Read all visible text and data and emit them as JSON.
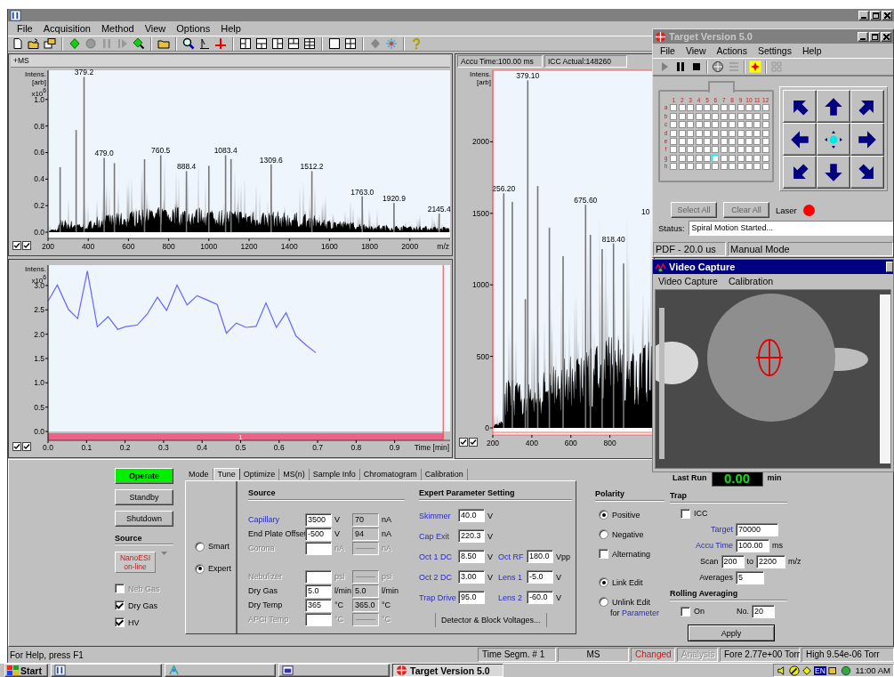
{
  "main_window": {
    "menu": [
      "File",
      "Acquisition",
      "Method",
      "View",
      "Options",
      "Help"
    ]
  },
  "spectrum": {
    "title": "+MS",
    "y_exponent": "x10$^{6}$",
    "trace_toggles": [
      {
        "checked": true
      },
      {
        "checked": true
      }
    ],
    "chart_data": {
      "type": "bar",
      "xlabel": "m/z",
      "ylabel": "Intens. [arb]",
      "xlim": [
        200,
        2200
      ],
      "ylim": [
        0,
        1.22
      ],
      "x": [
        260,
        340,
        379.2,
        479.0,
        530,
        680,
        760.5,
        888.4,
        1000,
        1083.4,
        1110,
        1309.6,
        1512.2,
        1763.0,
        1920.9,
        2145.4
      ],
      "values": [
        0.49,
        0.77,
        1.17,
        0.56,
        0.52,
        0.55,
        0.58,
        0.46,
        0.5,
        0.58,
        0.55,
        0.51,
        0.46,
        0.27,
        0.22,
        0.14
      ],
      "xticks": [
        200,
        400,
        600,
        800,
        1000,
        1200,
        1400,
        1600,
        1800,
        2000
      ],
      "yticks": [
        {
          "value": 0,
          "label": "0.0"
        },
        {
          "value": 0.2,
          "label": "0.2"
        },
        {
          "value": 0.4,
          "label": "0.4"
        },
        {
          "value": 0.6,
          "label": "0.6"
        },
        {
          "value": 0.8,
          "label": "0.8"
        },
        {
          "value": 1.0,
          "label": "1.0"
        }
      ],
      "annotations": [
        {
          "x": 379.2,
          "y": 1.17,
          "text": "379.2"
        },
        {
          "x": 479.0,
          "y": 0.56,
          "text": "479.0"
        },
        {
          "x": 760.5,
          "y": 0.58,
          "text": "760.5"
        },
        {
          "x": 888.4,
          "y": 0.46,
          "text": "888.4"
        },
        {
          "x": 1083.4,
          "y": 0.58,
          "text": "1083.4"
        },
        {
          "x": 1309.6,
          "y": 0.51,
          "text": "1309.6"
        },
        {
          "x": 1512.2,
          "y": 0.46,
          "text": "1512.2"
        },
        {
          "x": 1763.0,
          "y": 0.27,
          "text": "1763.0"
        },
        {
          "x": 1920.9,
          "y": 0.22,
          "text": "1920.9"
        },
        {
          "x": 2145.4,
          "y": 0.14,
          "text": "2145.4"
        }
      ]
    }
  },
  "live_spectrum": {
    "accu_time": "Accu Time:100.00 ms",
    "icc_actual": "ICC Actual:148260",
    "trace_toggles": [
      {
        "checked": true
      },
      {
        "checked": true
      }
    ],
    "chart_data": {
      "type": "bar",
      "ylabel": "Intens. [arb]",
      "xlim": [
        200,
        1025
      ],
      "ylim": [
        0,
        2500
      ],
      "x": [
        256.2,
        300,
        367,
        379.1,
        430,
        490,
        560,
        675.6,
        700,
        760,
        818.4,
        870
      ],
      "values": [
        1640,
        1580,
        900,
        2430,
        1690,
        1400,
        1200,
        1560,
        1350,
        1250,
        1290,
        1150
      ],
      "xticks": [
        200,
        400,
        600,
        800
      ],
      "yticks": [
        0,
        500,
        1000,
        1500,
        2000
      ],
      "annotations": [
        {
          "x": 256.2,
          "y": 1640,
          "text": "256.20"
        },
        {
          "x": 379.1,
          "y": 2430,
          "text": "379.10"
        },
        {
          "x": 675.6,
          "y": 1560,
          "text": "675.60"
        },
        {
          "x": 818.4,
          "y": 1290,
          "text": "818.40"
        }
      ]
    },
    "cut_label": "10"
  },
  "chromatogram": {
    "y_exponent": "x10$^{6}$",
    "segment_label": "1",
    "trace_toggles": [
      {
        "checked": true
      },
      {
        "checked": true
      }
    ],
    "chart_data": {
      "type": "line",
      "xlabel": "Time [min]",
      "ylabel": "Intens.",
      "xlim": [
        0,
        1.044
      ],
      "ylim": [
        0,
        3.42
      ],
      "ref_lines": [
        {
          "axis": "x",
          "value": 1.026
        }
      ],
      "x": [
        0,
        0.024,
        0.053,
        0.077,
        0.102,
        0.128,
        0.156,
        0.181,
        0.2,
        0.232,
        0.258,
        0.284,
        0.308,
        0.335,
        0.361,
        0.387,
        0.414,
        0.439,
        0.463,
        0.489,
        0.514,
        0.54,
        0.566,
        0.593,
        0.618,
        0.644,
        0.671,
        0.695
      ],
      "series": [
        {
          "values": [
            2.68,
            3.01,
            2.51,
            2.32,
            3.3,
            2.15,
            2.36,
            2.1,
            2.15,
            2.19,
            2.42,
            2.76,
            2.49,
            3.01,
            2.6,
            2.79,
            2.7,
            2.61,
            2.02,
            2.23,
            2.14,
            2.16,
            2.64,
            2.14,
            2.44,
            1.96,
            1.77,
            1.62
          ]
        }
      ],
      "xticks": [
        {
          "value": 0,
          "label": "0.0"
        },
        {
          "value": 0.1,
          "label": "0.1"
        },
        {
          "value": 0.2,
          "label": "0.2"
        },
        {
          "value": 0.3,
          "label": "0.3"
        },
        {
          "value": 0.4,
          "label": "0.4"
        },
        {
          "value": 0.5,
          "label": "0.5"
        },
        {
          "value": 0.6,
          "label": "0.6"
        },
        {
          "value": 0.7,
          "label": "0.7"
        },
        {
          "value": 0.8,
          "label": "0.8"
        },
        {
          "value": 0.9,
          "label": "0.9"
        }
      ],
      "yticks": [
        {
          "value": 0,
          "label": "0.0"
        },
        {
          "value": 0.5,
          "label": "0.5"
        },
        {
          "value": 1,
          "label": "1.0"
        },
        {
          "value": 1.5,
          "label": "1.5"
        },
        {
          "value": 2,
          "label": "2.0"
        },
        {
          "value": 2.5,
          "label": "2.5"
        },
        {
          "value": 3,
          "label": "3.0"
        }
      ]
    }
  },
  "control_panel": {
    "mode_buttons": [
      {
        "label": "Operate",
        "selected": true
      },
      {
        "label": "Standby",
        "selected": false
      },
      {
        "label": "Shutdown",
        "selected": false
      }
    ],
    "source_heading": "Source",
    "source_select": "NanoESI on-line",
    "gas_checks": [
      {
        "label": "Neb Gas",
        "checked": false,
        "disabled": true
      },
      {
        "label": "Dry Gas",
        "checked": true,
        "disabled": false
      },
      {
        "label": "HV",
        "checked": true,
        "disabled": false
      }
    ],
    "tabs": [
      {
        "label": "Mode",
        "selected": false
      },
      {
        "label": "Tune",
        "selected": true
      },
      {
        "label": "Optimize",
        "selected": false
      },
      {
        "label": "MS(n)",
        "selected": false
      },
      {
        "label": "Sample Info",
        "selected": false
      },
      {
        "label": "Chromatogram",
        "selected": false
      },
      {
        "label": "Calibration",
        "selected": false
      }
    ],
    "tune_modes": [
      {
        "label": "Smart",
        "selected": false
      },
      {
        "label": "Expert",
        "selected": true
      }
    ],
    "source_group": {
      "title": "Source",
      "rows": [
        {
          "label": "Capillary",
          "linked": true,
          "disabled": false,
          "value": "3500",
          "unit": "V",
          "reading": "70",
          "reading_unit": "nA"
        },
        {
          "label": "End Plate Offset",
          "linked": false,
          "disabled": false,
          "value": "-500",
          "unit": "V",
          "reading": "94",
          "reading_unit": "nA"
        },
        {
          "label": "Corona",
          "linked": false,
          "disabled": true,
          "unit": "nA",
          "reading_unit": "nA"
        },
        {
          "label": "Nebulizer",
          "linked": false,
          "disabled": true,
          "unit": "psi",
          "reading_unit": "psi"
        },
        {
          "label": "Dry Gas",
          "linked": false,
          "disabled": false,
          "value": "5.0",
          "unit": "l/min",
          "reading": "5.0",
          "reading_unit": "l/min"
        },
        {
          "label": "Dry Temp",
          "linked": false,
          "disabled": false,
          "value": "365",
          "unit": "°C",
          "reading": "365.0",
          "reading_unit": "°C"
        },
        {
          "label": "APCI Temp",
          "linked": false,
          "disabled": true,
          "unit": "°C",
          "reading_unit": "°C"
        }
      ]
    },
    "expert_group": {
      "title": "Expert Parameter Setting",
      "rows": [
        {
          "fields": [
            {
              "label": "Skimmer",
              "value": "40.0",
              "unit": "V"
            }
          ]
        },
        {
          "fields": [
            {
              "label": "Cap Exit",
              "value": "220.3",
              "unit": "V"
            }
          ]
        },
        {
          "fields": [
            {
              "label": "Oct 1 DC",
              "value": "8.50",
              "unit": "V"
            },
            {
              "label": "Oct RF",
              "value": "180.0",
              "unit": "Vpp"
            }
          ]
        },
        {
          "fields": [
            {
              "label": "Oct 2 DC",
              "value": "3.00",
              "unit": "V"
            },
            {
              "label": "Lens 1",
              "value": "-5.0",
              "unit": "V"
            }
          ]
        },
        {
          "fields": [
            {
              "label": "Trap Drive",
              "value": "95.0"
            },
            {
              "label": "Lens 2",
              "value": "-60.0",
              "unit": "V"
            }
          ]
        }
      ],
      "button": "Detector & Block Voltages..."
    },
    "polarity": {
      "title": "Polarity",
      "options": [
        {
          "label": "Positive",
          "selected": true
        },
        {
          "label": "Negative",
          "selected": false
        }
      ],
      "alternating": {
        "label": "Alternating",
        "checked": false
      },
      "edit_modes": [
        {
          "label": "Link Edit",
          "selected": true
        },
        {
          "label": "Unlink Edit",
          "selected": false
        }
      ],
      "edit_note": "for",
      "edit_note_param": "Parameter"
    },
    "last_run": {
      "label": "Last Run",
      "value": "0.00",
      "unit": "min"
    },
    "trap": {
      "title": "Trap",
      "icc": {
        "label": "ICC",
        "checked": false
      },
      "target": {
        "label": "Target",
        "value": "70000"
      },
      "accu_time": {
        "label": "Accu Time",
        "value": "100.00",
        "unit": "ms"
      },
      "scan": {
        "label": "Scan",
        "from": "200",
        "to_label": "to",
        "to": "2200",
        "unit": "m/z"
      },
      "averages": {
        "label": "Averages",
        "value": "5"
      }
    },
    "rolling": {
      "title": "Rolling Averaging",
      "on": {
        "label": "On",
        "checked": false
      },
      "number": {
        "label": "No.",
        "value": "20"
      }
    },
    "apply_button": "Apply"
  },
  "status_bar": {
    "help": "For Help, press F1",
    "panes": [
      {
        "text": "Time Segm. # 1",
        "kind": "normal"
      },
      {
        "text": "MS",
        "kind": "center"
      },
      {
        "text": "Changed",
        "kind": "alert"
      },
      {
        "text": "Analysis",
        "kind": "disabled"
      },
      {
        "text": "Fore 2.77e+00 Torr",
        "kind": "normal"
      },
      {
        "text": "High 9.54e-06 Torr",
        "kind": "normal"
      }
    ]
  },
  "target_window": {
    "title": "Target Version 5.0",
    "menu": [
      "File",
      "View",
      "Actions",
      "Settings",
      "Help"
    ],
    "plate": {
      "columns": [
        "1",
        "2",
        "3",
        "4",
        "5",
        "6",
        "7",
        "8",
        "9",
        "10",
        "11",
        "12"
      ],
      "rows": [
        {
          "label": "a",
          "selected": [
            false,
            false,
            false,
            false,
            false,
            false,
            false,
            false,
            false,
            false,
            false,
            false
          ]
        },
        {
          "label": "b",
          "selected": [
            false,
            false,
            false,
            false,
            false,
            false,
            false,
            false,
            false,
            false,
            false,
            false
          ]
        },
        {
          "label": "c",
          "selected": [
            false,
            false,
            false,
            false,
            false,
            false,
            false,
            false,
            false,
            false,
            false,
            false
          ]
        },
        {
          "label": "d",
          "selected": [
            false,
            false,
            false,
            false,
            false,
            false,
            false,
            false,
            false,
            false,
            false,
            false
          ]
        },
        {
          "label": "e",
          "selected": [
            false,
            false,
            false,
            false,
            false,
            false,
            false,
            false,
            false,
            false,
            false,
            false
          ]
        },
        {
          "label": "f",
          "selected": [
            false,
            false,
            false,
            false,
            false,
            false,
            false,
            false,
            false,
            false,
            false,
            false
          ]
        },
        {
          "label": "g",
          "selected": [
            false,
            false,
            false,
            false,
            false,
            true,
            false,
            false,
            false,
            false,
            false,
            false
          ]
        },
        {
          "label": "h",
          "selected": [
            false,
            false,
            false,
            false,
            false,
            false,
            false,
            false,
            false,
            false,
            false,
            false
          ]
        }
      ]
    },
    "buttons": [
      {
        "label": "Select All",
        "disabled": true
      },
      {
        "label": "Clear All",
        "disabled": true
      }
    ],
    "laser": {
      "label": "Laser",
      "on": true
    },
    "status": {
      "label": "Status:",
      "value": "Spiral Motion Started..."
    },
    "status_panes": [
      "PDF - 20.0 us",
      "Manual Mode"
    ]
  },
  "video_window": {
    "title": "Video Capture",
    "menu": [
      "Video Capture",
      "Calibration"
    ]
  },
  "taskbar": {
    "start": "Start",
    "tasks": [
      {
        "selected": false
      },
      {
        "selected": false
      },
      {
        "selected": false
      },
      {
        "label": "Target Version 5.0",
        "selected": true
      }
    ],
    "language": "EN",
    "clock": "11:00 AM"
  }
}
